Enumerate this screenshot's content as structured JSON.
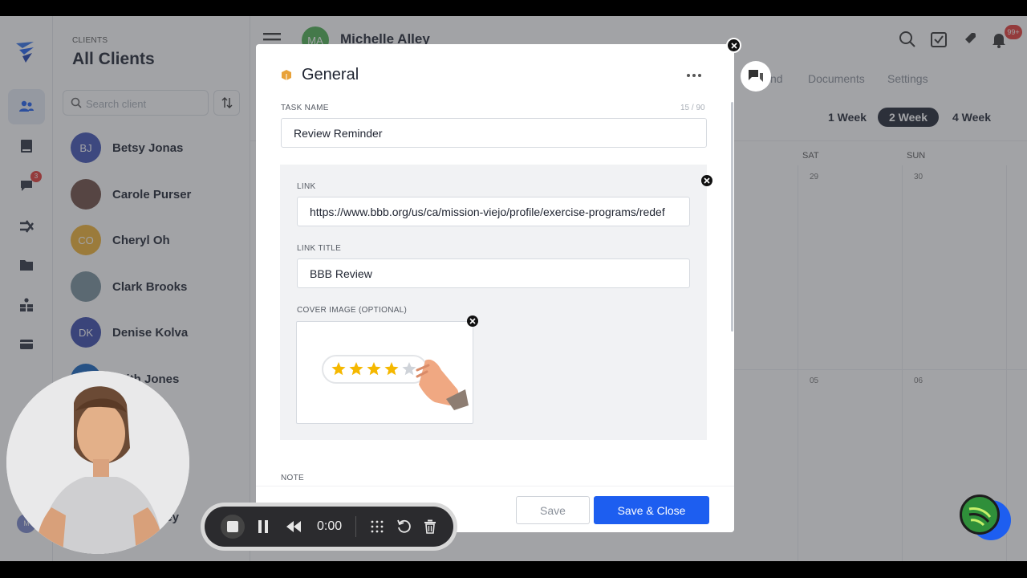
{
  "nav": {
    "chat_badge": "3",
    "avatar_initials": "M"
  },
  "clients": {
    "eyebrow": "CLIENTS",
    "title": "All Clients",
    "search_placeholder": "Search client",
    "list": [
      {
        "initials": "BJ",
        "name": "Betsy Jonas",
        "color": "#3f51b5"
      },
      {
        "initials": "",
        "name": "Carole Purser",
        "color": "#6d4c41"
      },
      {
        "initials": "CO",
        "name": "Cheryl Oh",
        "color": "#f2b233"
      },
      {
        "initials": "",
        "name": "Clark Brooks",
        "color": "#78909c"
      },
      {
        "initials": "DK",
        "name": "Denise Kolva",
        "color": "#3949ab"
      },
      {
        "initials": "",
        "name": "Faith Jones",
        "color": "#1565c0"
      }
    ],
    "partial_name": "lley"
  },
  "header": {
    "avatar_initials": "MA",
    "client_name": "Michelle Alley",
    "notification_badge": "99+",
    "tabs": [
      "nd",
      "Documents",
      "Settings"
    ]
  },
  "calendar": {
    "weeks": [
      "1 Week",
      "2 Week",
      "4 Week"
    ],
    "active_week": "2 Week",
    "day_headers": [
      "SAT",
      "SUN"
    ],
    "dates_row1": [
      "29",
      "30"
    ],
    "dates_row2": [
      "05",
      "06"
    ]
  },
  "modal": {
    "title": "General",
    "task_name_label": "TASK NAME",
    "char_count": "15 / 90",
    "task_name_value": "Review Reminder",
    "link_label": "LINK",
    "link_value": "https://www.bbb.org/us/ca/mission-viejo/profile/exercise-programs/redef",
    "link_title_label": "LINK TITLE",
    "link_title_value": "BBB Review",
    "cover_image_label": "COVER IMAGE (OPTIONAL)",
    "note_label": "NOTE",
    "save_label": "Save",
    "save_close_label": "Save & Close",
    "stars_filled": 4,
    "stars_total": 5
  },
  "recorder": {
    "time": "0:00"
  },
  "colors": {
    "primary": "#1d5ef0",
    "dark": "#1e2330",
    "star": "#f5b800"
  }
}
